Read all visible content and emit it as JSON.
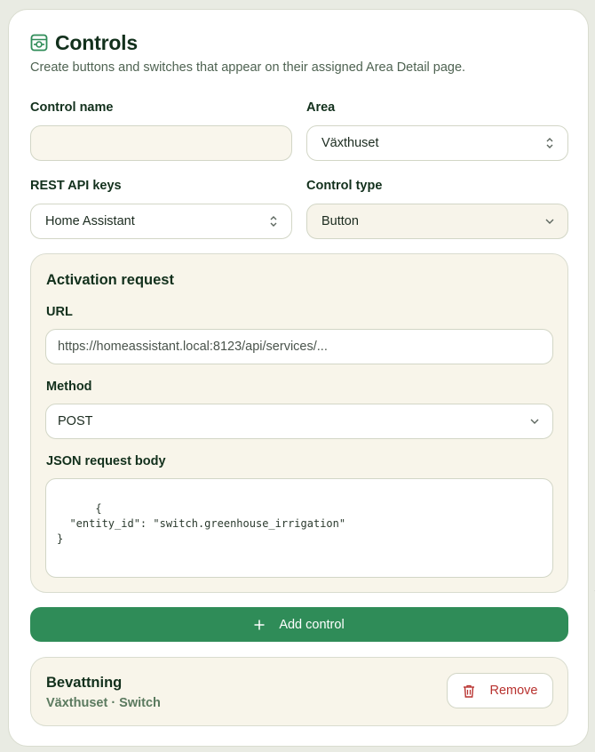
{
  "header": {
    "title": "Controls",
    "subtitle": "Create buttons and switches that appear on their assigned Area Detail page.",
    "icon": "control-panel-icon"
  },
  "form": {
    "control_name": {
      "label": "Control name",
      "value": "",
      "placeholder": ""
    },
    "area": {
      "label": "Area",
      "selected": "Växthuset"
    },
    "rest_api_keys": {
      "label": "REST API keys",
      "selected": "Home Assistant"
    },
    "control_type": {
      "label": "Control type",
      "selected": "Button"
    }
  },
  "activation_request": {
    "title": "Activation request",
    "url": {
      "label": "URL",
      "value": "https://homeassistant.local:8123/api/services/..."
    },
    "method": {
      "label": "Method",
      "selected": "POST"
    },
    "json_body": {
      "label": "JSON request body",
      "value": "{\n  \"entity_id\": \"switch.greenhouse_irrigation\"\n}"
    }
  },
  "add_button": {
    "label": "Add control",
    "icon": "plus-icon"
  },
  "controls_list": [
    {
      "name": "Bevattning",
      "meta": "Växthuset · Switch",
      "remove_label": "Remove",
      "remove_icon": "trash-icon"
    }
  ],
  "colors": {
    "accent": "#2f8c58",
    "danger": "#b8322f",
    "panel_bg": "#f8f5ea",
    "text_dark": "#12301c"
  }
}
